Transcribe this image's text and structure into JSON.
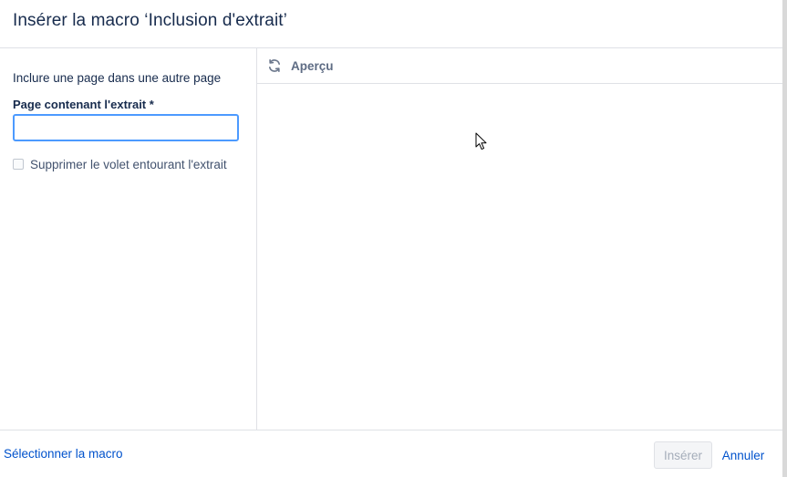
{
  "dialog": {
    "title": "Insérer la macro ‘Inclusion d'extrait’"
  },
  "left_panel": {
    "description": "Inclure une page dans une autre page",
    "page_field": {
      "label": "Page contenant l'extrait *",
      "value": "",
      "placeholder": ""
    },
    "suppress_checkbox": {
      "label": "Supprimer le volet entourant l'extrait",
      "checked": false
    }
  },
  "preview": {
    "title": "Aperçu",
    "icon": "refresh-icon"
  },
  "footer": {
    "select_macro_label": "Sélectionner la macro",
    "insert_label": "Insérer",
    "insert_disabled": true,
    "cancel_label": "Annuler"
  },
  "colors": {
    "text": "#172b4d",
    "link": "#0052cc",
    "focus_border": "#4c9aff",
    "border": "#dfe1e6",
    "disabled_text": "#a5adba",
    "muted": "#5e6c84"
  }
}
